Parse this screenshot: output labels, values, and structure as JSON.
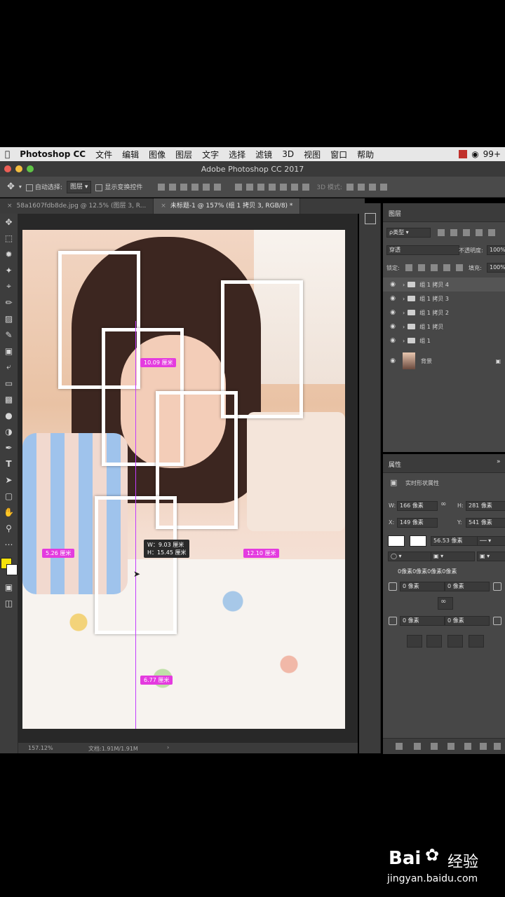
{
  "menubar": {
    "app": "Photoshop CC",
    "items": [
      "文件",
      "编辑",
      "图像",
      "图层",
      "文字",
      "选择",
      "滤镜",
      "3D",
      "视图",
      "窗口",
      "帮助"
    ],
    "badge": "99+"
  },
  "window": {
    "title": "Adobe Photoshop CC 2017"
  },
  "options": {
    "auto_select": "自动选择:",
    "auto_select_value": "图层",
    "show_transform": "显示变换控件",
    "mode_3d": "3D 模式:"
  },
  "tabs": [
    {
      "label": "58a1607fdb8de.jpg @ 12.5% (图层 3, R..."
    },
    {
      "label": "未标题-1 @ 157% (组 1 拷贝 3, RGB/8) *"
    }
  ],
  "canvas": {
    "measure_top": "10.09 厘米",
    "measure_left": "5.26 厘米",
    "measure_right": "12.10 厘米",
    "measure_bottom": "6.77 厘米",
    "tooltip_w": "W：9.03 厘米",
    "tooltip_h": "H：15.45 厘米"
  },
  "layers": {
    "title": "图层",
    "kind": "ρ类型",
    "blend": "穿透",
    "opacity_label": "不透明度:",
    "opacity": "100%",
    "lock_label": "锁定:",
    "fill_label": "填充:",
    "fill": "100%",
    "items": [
      {
        "name": "组 1 拷贝 4"
      },
      {
        "name": "组 1 拷贝 3"
      },
      {
        "name": "组 1 拷贝 2"
      },
      {
        "name": "组 1 拷贝"
      },
      {
        "name": "组 1"
      },
      {
        "name": "背景"
      }
    ]
  },
  "properties": {
    "title": "属性",
    "shape_title": "实时形状属性",
    "w_label": "W:",
    "w": "166 像素",
    "h_label": "H:",
    "h": "281 像素",
    "x_label": "X:",
    "x": "149 像素",
    "y_label": "Y:",
    "y": "541 像素",
    "stroke": "56.53 像素",
    "corners": "0像素0像素0像素0像素",
    "r1": "0 像素",
    "r2": "0 像素",
    "r3": "0 像素",
    "r4": "0 像素"
  },
  "status": {
    "zoom": "157.12%",
    "doc": "文档:1.91M/1.91M"
  },
  "watermark": {
    "brand": "Bai",
    "brand2": "经验",
    "url": "jingyan.baidu.com"
  }
}
